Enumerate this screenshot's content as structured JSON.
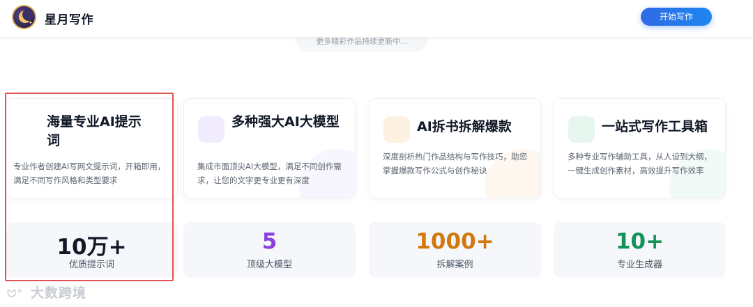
{
  "header": {
    "brand": "星月写作",
    "start_button": "开始写作"
  },
  "more_pill": "更多精彩作品持续更新中...",
  "cards": [
    {
      "title": "海量专业AI提示词",
      "desc": "专业作者创建AI写网文提示词，开箱即用，满足不同写作风格和类型要求",
      "accent": "#f3f4f6"
    },
    {
      "title": "多种强大AI大模型",
      "desc": "集成市面顶尖AI大模型，满足不同创作需求，让您的文字更专业更有深度",
      "accent": "#f1ecfd"
    },
    {
      "title": "AI拆书拆解爆款",
      "desc": "深度剖析热门作品结构与写作技巧，助您掌握爆款写作公式与创作秘诀",
      "accent": "#fdf1e2"
    },
    {
      "title": "一站式写作工具箱",
      "desc": "多种专业写作辅助工具，从人设到大纲，一键生成创作素材，高效提升写作效率",
      "accent": "#e6f6ef"
    }
  ],
  "stats": [
    {
      "value": "10万+",
      "label": "优质提示词",
      "color": "#111827"
    },
    {
      "value": "5",
      "label": "顶级大模型",
      "color": "#8b3fe0"
    },
    {
      "value": "1000+",
      "label": "拆解案例",
      "color": "#d2780f"
    },
    {
      "value": "10+",
      "label": "专业生成器",
      "color": "#13925a"
    }
  ],
  "watermark": "大数跨境"
}
